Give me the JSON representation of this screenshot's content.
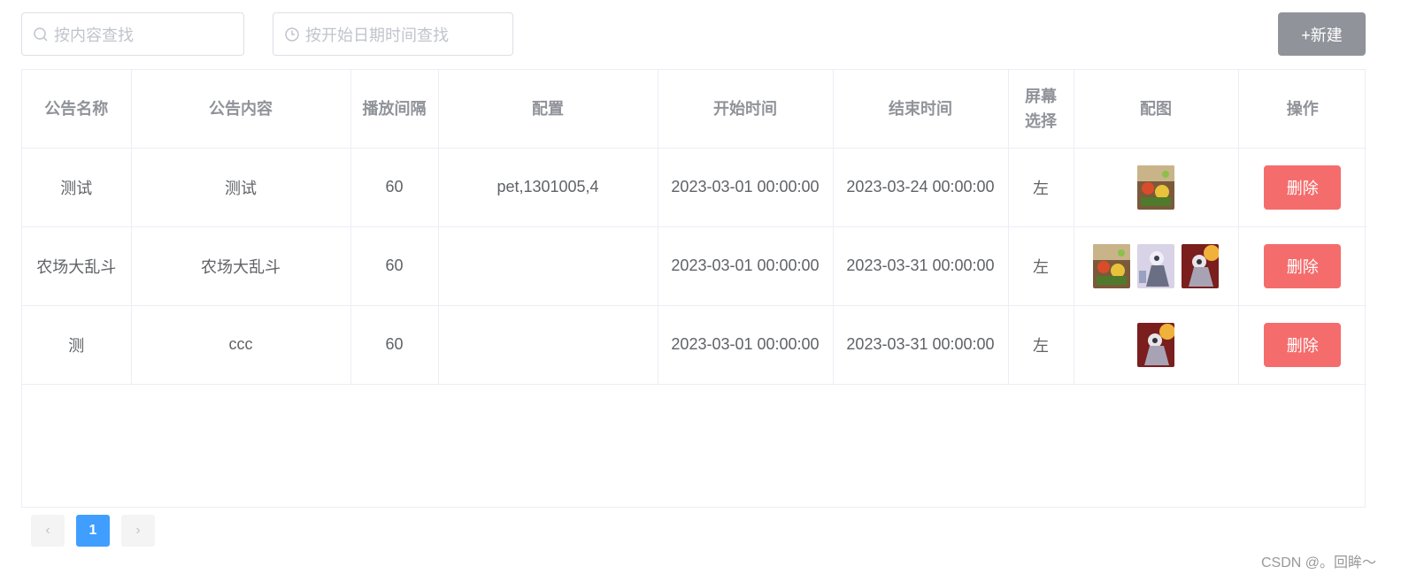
{
  "search": {
    "content_placeholder": "按内容查找",
    "date_placeholder": "按开始日期时间查找"
  },
  "toolbar": {
    "new_label": "+新建"
  },
  "table": {
    "headers": [
      "公告名称",
      "公告内容",
      "播放间隔",
      "配置",
      "开始时间",
      "结束时间",
      "屏幕\n选择",
      "配图",
      "操作"
    ],
    "rows": [
      {
        "name": "测试",
        "content": "测试",
        "interval": "60",
        "config": "pet,1301005,4",
        "start": "2023-03-01 00:00:00",
        "end": "2023-03-24 00:00:00",
        "screen": "左",
        "images": [
          "farm-battle-image"
        ],
        "action": "删除"
      },
      {
        "name": "农场大乱斗",
        "content": "农场大乱斗",
        "interval": "60",
        "config": "",
        "start": "2023-03-01 00:00:00",
        "end": "2023-03-31 00:00:00",
        "screen": "左",
        "images": [
          "farm-battle-image",
          "character-art-image",
          "character-fire-image"
        ],
        "action": "删除"
      },
      {
        "name": "测",
        "content": "ccc",
        "interval": "60",
        "config": "",
        "start": "2023-03-01 00:00:00",
        "end": "2023-03-31 00:00:00",
        "screen": "左",
        "images": [
          "character-fire-image"
        ],
        "action": "删除"
      }
    ]
  },
  "pagination": {
    "current": "1",
    "prev_icon": "chevron-left-icon",
    "next_icon": "chevron-right-icon"
  },
  "watermark": "CSDN @。回眸～",
  "colors": {
    "danger": "#f56c6c",
    "primary": "#409eff",
    "info": "#909399"
  }
}
